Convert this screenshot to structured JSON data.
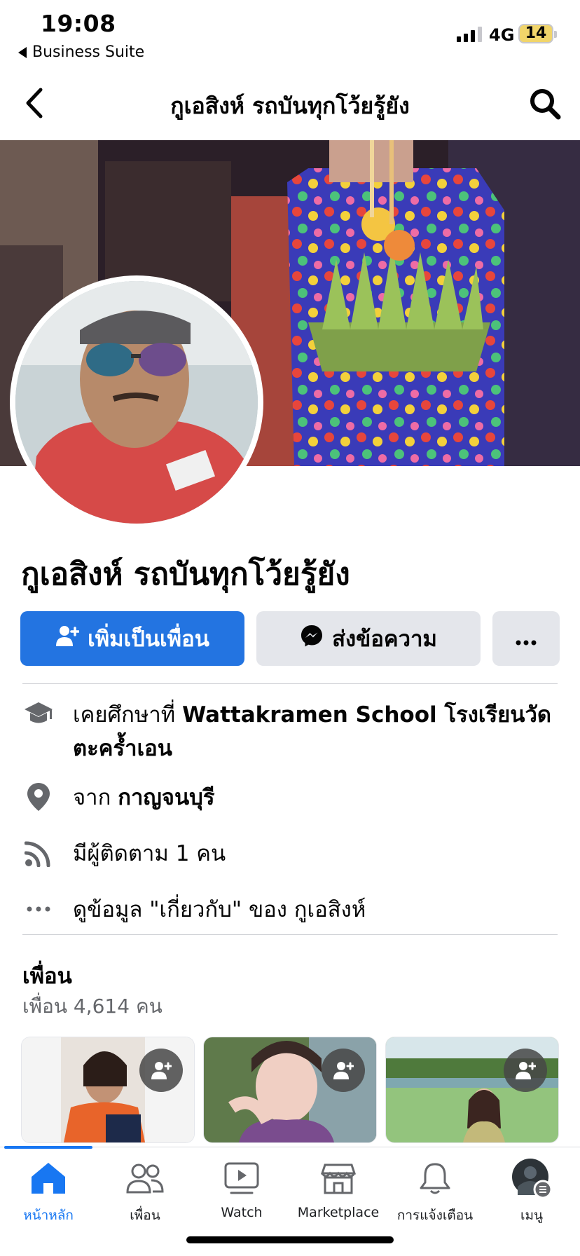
{
  "status_bar": {
    "time": "19:08",
    "back_app": "Business Suite",
    "network": "4G",
    "battery": "14"
  },
  "header": {
    "title": "กูเอสิงห์ รถบันทุกโว้ยรู้ยัง",
    "back_icon": "chevron-left-icon",
    "search_icon": "search-icon"
  },
  "profile": {
    "name": "กูเอสิงห์ รถบันทุกโว้ยรู้ยัง"
  },
  "actions": {
    "add_friend": "เพิ่มเป็นเพื่อน",
    "message": "ส่งข้อความ",
    "more_icon": "more-horizontal-icon"
  },
  "info": {
    "education_prefix": "เคยศึกษาที่ ",
    "education_value": "Wattakramen School โรงเรียนวัดตะคร้ำเอน",
    "from_prefix": "จาก ",
    "from_value": "กาญจนบุรี",
    "followers": "มีผู้ติดตาม 1 คน",
    "about": "ดูข้อมูล \"เกี่ยวกับ\" ของ กูเอสิงห์"
  },
  "friends": {
    "title": "เพื่อน",
    "count": "เพื่อน 4,614 คน"
  },
  "tabs": [
    {
      "label": "หน้าหลัก",
      "icon": "home-icon",
      "active": true
    },
    {
      "label": "เพื่อน",
      "icon": "friends-icon"
    },
    {
      "label": "Watch",
      "icon": "watch-icon"
    },
    {
      "label": "Marketplace",
      "icon": "marketplace-icon"
    },
    {
      "label": "การแจ้งเตือน",
      "icon": "bell-icon"
    },
    {
      "label": "เมนู",
      "icon": "menu-avatar-icon"
    }
  ],
  "colors": {
    "accent": "#1877f2",
    "button_primary": "#2374e1",
    "button_secondary": "#e4e6eb"
  }
}
